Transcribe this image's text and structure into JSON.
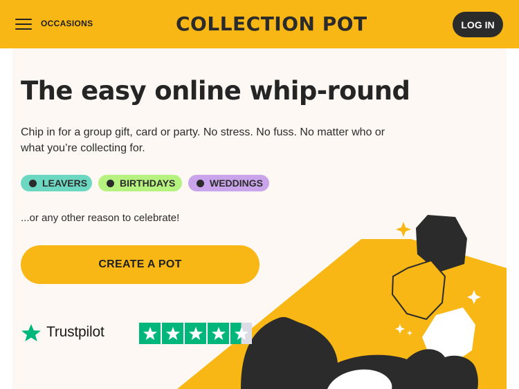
{
  "header": {
    "menu_icon": "hamburger-menu-icon",
    "occasions_label": "OCCASIONS",
    "logo_text": "COLLECTION POT",
    "login_label": "LOG IN"
  },
  "hero": {
    "title": "The easy online whip-round",
    "subtitle": "Chip in for a group gift, card or party. No stress. No fuss. No matter who or what you’re collecting for.",
    "chips": [
      {
        "label": "LEAVERS",
        "color": "#6dd8c1"
      },
      {
        "label": "BIRTHDAYS",
        "color": "#b6f27f"
      },
      {
        "label": "WEDDINGS",
        "color": "#c9a4ea"
      }
    ],
    "other_text": "...or any other reason to celebrate!",
    "cta_label": "CREATE A POT"
  },
  "trustpilot": {
    "brand": "Trustpilot",
    "rating_stars": 4.5,
    "max_stars": 5
  },
  "colors": {
    "brand_yellow": "#f8b714",
    "dark": "#2b2b2b",
    "panel_bg": "#fdf8f3",
    "trustpilot_green": "#00b67a"
  }
}
